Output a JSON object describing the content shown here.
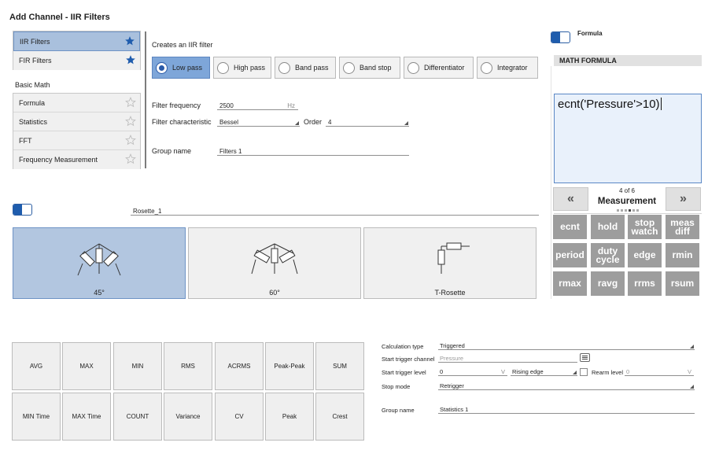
{
  "window": {
    "title": "Add Channel - IIR Filters"
  },
  "categories": {
    "top_items": [
      {
        "label": "IIR Filters",
        "starred": true,
        "selected": true
      },
      {
        "label": "FIR Filters",
        "starred": true,
        "selected": false
      }
    ],
    "basic_math_heading": "Basic Math",
    "basic_math_items": [
      {
        "label": "Formula",
        "starred": false
      },
      {
        "label": "Statistics",
        "starred": false
      },
      {
        "label": "FFT",
        "starred": false
      },
      {
        "label": "Frequency Measurement",
        "starred": false
      }
    ]
  },
  "iir": {
    "heading": "Creates an IIR filter",
    "filter_types": [
      {
        "label": "Low pass",
        "selected": true
      },
      {
        "label": "High pass",
        "selected": false
      },
      {
        "label": "Band pass",
        "selected": false
      },
      {
        "label": "Band stop",
        "selected": false
      },
      {
        "label": "Differentiator",
        "selected": false
      },
      {
        "label": "Integrator",
        "selected": false
      }
    ],
    "frequency_label": "Filter frequency",
    "frequency_value": "2500",
    "frequency_unit": "Hz",
    "characteristic_label": "Filter characteristic",
    "characteristic_value": "Bessel",
    "order_label": "Order",
    "order_value": "4",
    "group_label": "Group name",
    "group_value": "Filters 1"
  },
  "rosette": {
    "name_value": "Rosette_1",
    "cards": [
      {
        "label": "45°",
        "selected": true
      },
      {
        "label": "60°",
        "selected": false
      },
      {
        "label": "T-Rosette",
        "selected": false
      }
    ]
  },
  "statistics": {
    "buttons_row1": [
      "AVG",
      "MAX",
      "MIN",
      "RMS",
      "ACRMS",
      "Peak-Peak",
      "SUM"
    ],
    "buttons_row2": [
      "MIN Time",
      "MAX Time",
      "COUNT",
      "Variance",
      "CV",
      "Peak",
      "Crest"
    ],
    "calc_type_label": "Calculation type",
    "calc_type_value": "Triggered",
    "start_channel_label": "Start trigger channel",
    "start_channel_placeholder": "Pressure",
    "start_level_label": "Start trigger level",
    "start_level_value": "0",
    "start_level_unit": "V",
    "edge_value": "Rising edge",
    "rearm_label": "Rearm level",
    "rearm_value": "0",
    "rearm_unit": "V",
    "stop_mode_label": "Stop mode",
    "stop_mode_value": "Retrigger",
    "group_label": "Group name",
    "group_value": "Statistics 1"
  },
  "formula": {
    "toggle_label": "Formula",
    "header": "MATH FORMULA",
    "expression": "ecnt('Pressure'>10)",
    "page_indicator": "4 of 6",
    "category": "Measurement",
    "prev_symbol": "«",
    "next_symbol": "»",
    "keys": [
      [
        "ecnt",
        "hold",
        "stop watch",
        "meas diff"
      ],
      [
        "period",
        "duty cycle",
        "edge",
        "rmin"
      ],
      [
        "rmax",
        "ravg",
        "rrms",
        "rsum"
      ]
    ]
  },
  "colors": {
    "accent": "#1e5cad",
    "selected_bg": "#a9c0dd",
    "key_bg": "#9d9d9d"
  }
}
